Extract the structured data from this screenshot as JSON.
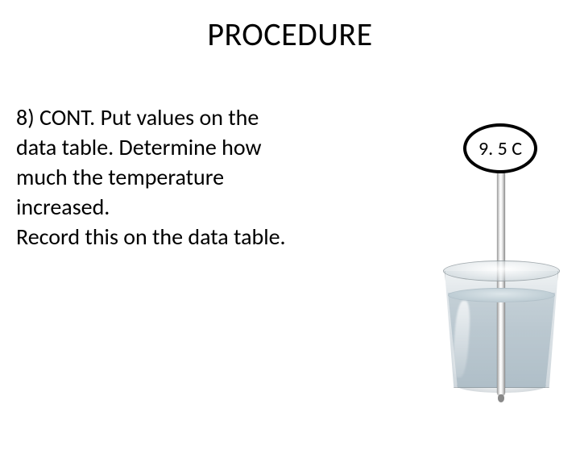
{
  "title": "PROCEDURE",
  "body": {
    "p1": "8) CONT.  Put values on the",
    "p2": "data table. Determine how",
    "p3": "much the temperature",
    "p4": "increased.",
    "p5": "Record this on the data table."
  },
  "callout_value": "9. 5 C"
}
